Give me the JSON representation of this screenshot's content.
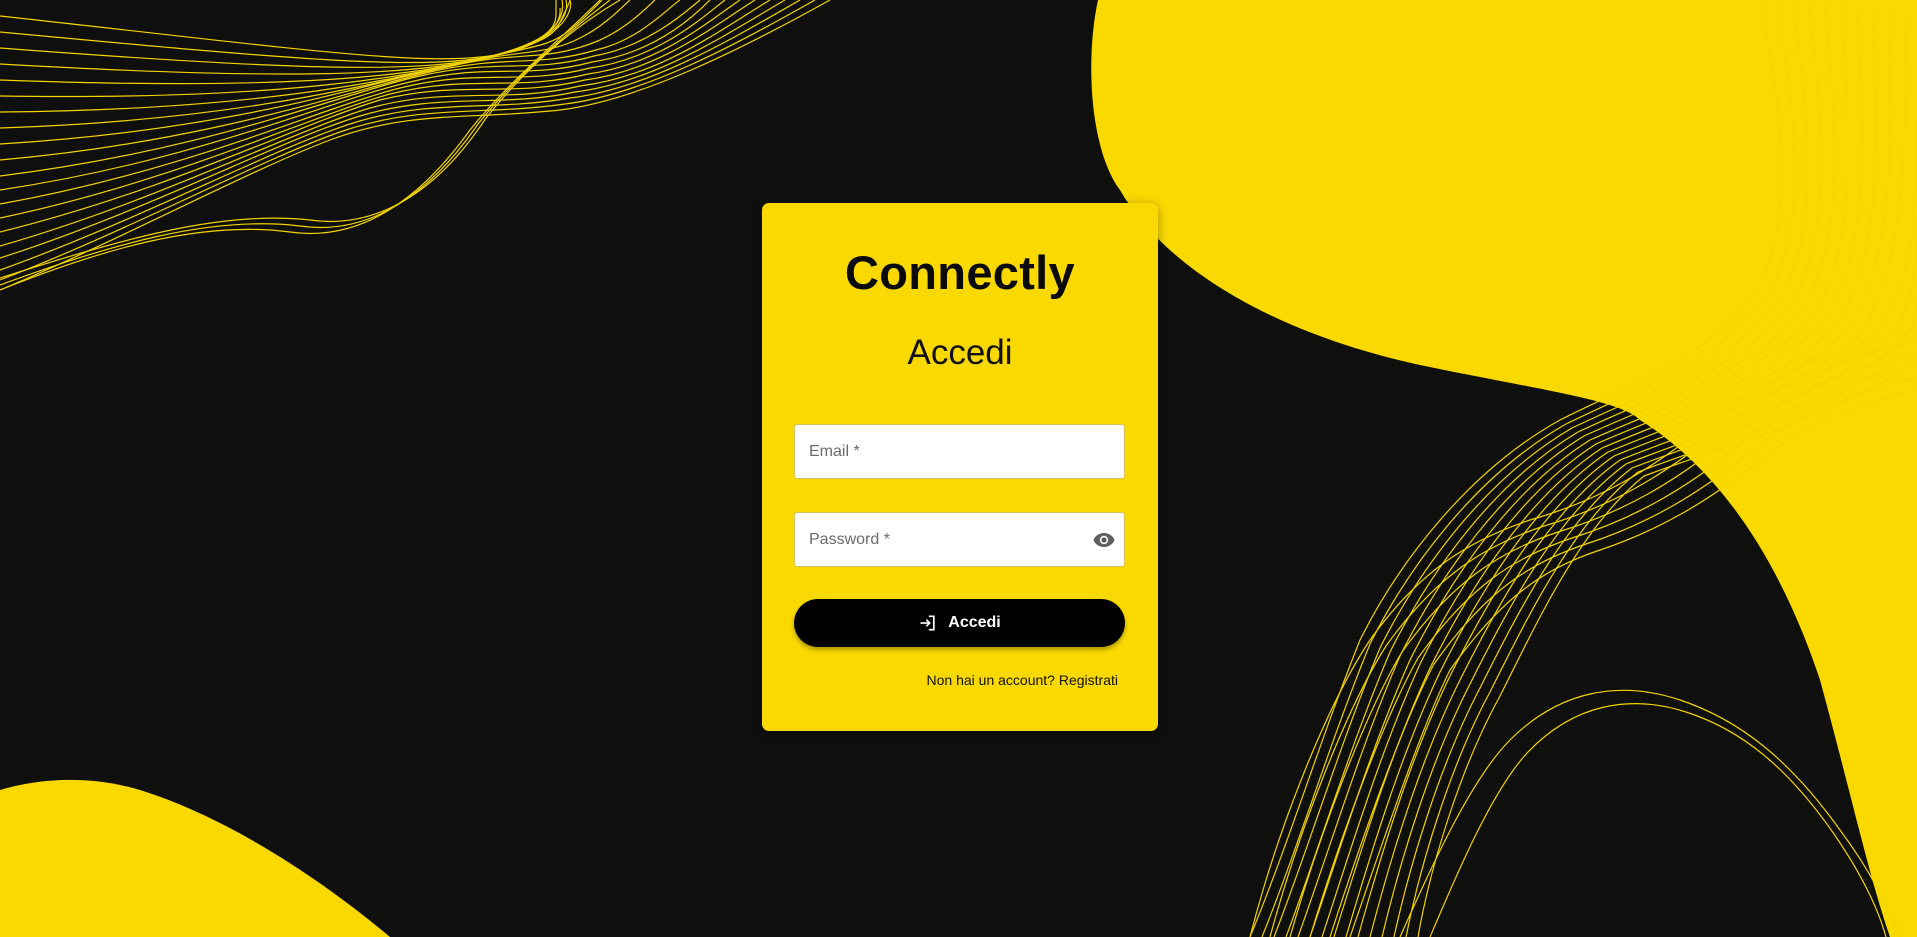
{
  "app": {
    "brand": "Connectly",
    "page_title": "Accedi"
  },
  "form": {
    "email_placeholder": "Email *",
    "email_value": "",
    "password_placeholder": "Password *",
    "password_value": "",
    "submit_label": "Accedi",
    "submit_icon": "login-icon",
    "password_toggle_icon": "eye-icon"
  },
  "footer": {
    "prompt": "Non hai un account?",
    "link_label": "Registrati"
  },
  "colors": {
    "accent": "#fad900",
    "background": "#0f0f0d",
    "button": "#000000"
  }
}
